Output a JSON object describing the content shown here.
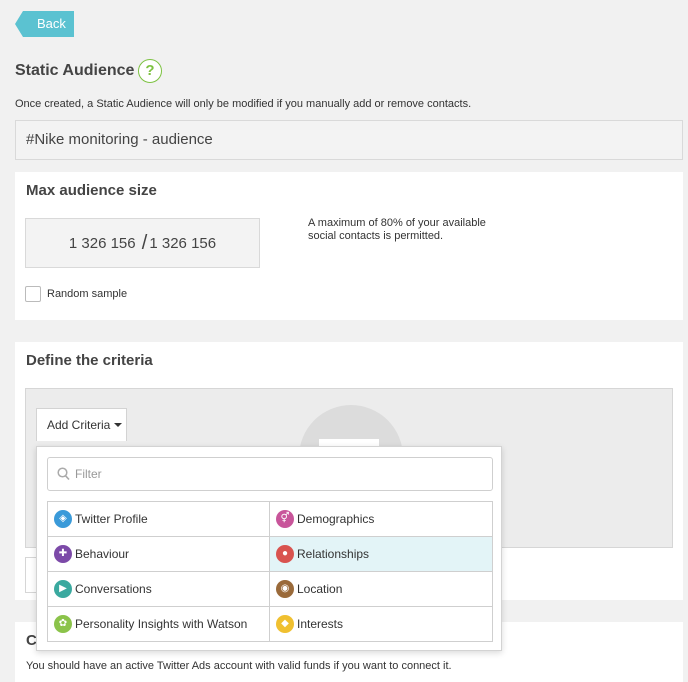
{
  "back_label": "Back",
  "page": {
    "title": "Static Audience",
    "help_icon": "question-icon",
    "description": "Once created, a Static Audience will only be modified if you manually add or remove contacts.",
    "audience_name": "#Nike monitoring - audience"
  },
  "max_size": {
    "title": "Max audience size",
    "current": "1 326 156",
    "separator": "/",
    "total": "1 326 156",
    "note": "A maximum of 80% of your available social contacts is permitted.",
    "random_sample_label": "Random sample",
    "random_sample_checked": false
  },
  "criteria": {
    "title": "Define the criteria",
    "add_label": "Add Criteria",
    "filter_placeholder": "Filter",
    "options": [
      {
        "label": "Twitter Profile",
        "icon": "twitter-icon",
        "color": "#3a9ad9"
      },
      {
        "label": "Demographics",
        "icon": "gender-icon",
        "color": "#c8559a"
      },
      {
        "label": "Behaviour",
        "icon": "puzzle-icon",
        "color": "#7c4aa8"
      },
      {
        "label": "Relationships",
        "icon": "people-icon",
        "color": "#d9534f"
      },
      {
        "label": "Conversations",
        "icon": "megaphone-icon",
        "color": "#3aa99f"
      },
      {
        "label": "Location",
        "icon": "map-pin-icon",
        "color": "#9a6a3a"
      },
      {
        "label": "Personality Insights with Watson",
        "icon": "watson-icon",
        "color": "#8bc34a"
      },
      {
        "label": "Interests",
        "icon": "diamond-icon",
        "color": "#f0c030"
      }
    ],
    "highlighted_option": "Relationships"
  },
  "connect": {
    "title_fragment": "C",
    "description": "You should have an active Twitter Ads account with valid funds if you want to connect it."
  }
}
